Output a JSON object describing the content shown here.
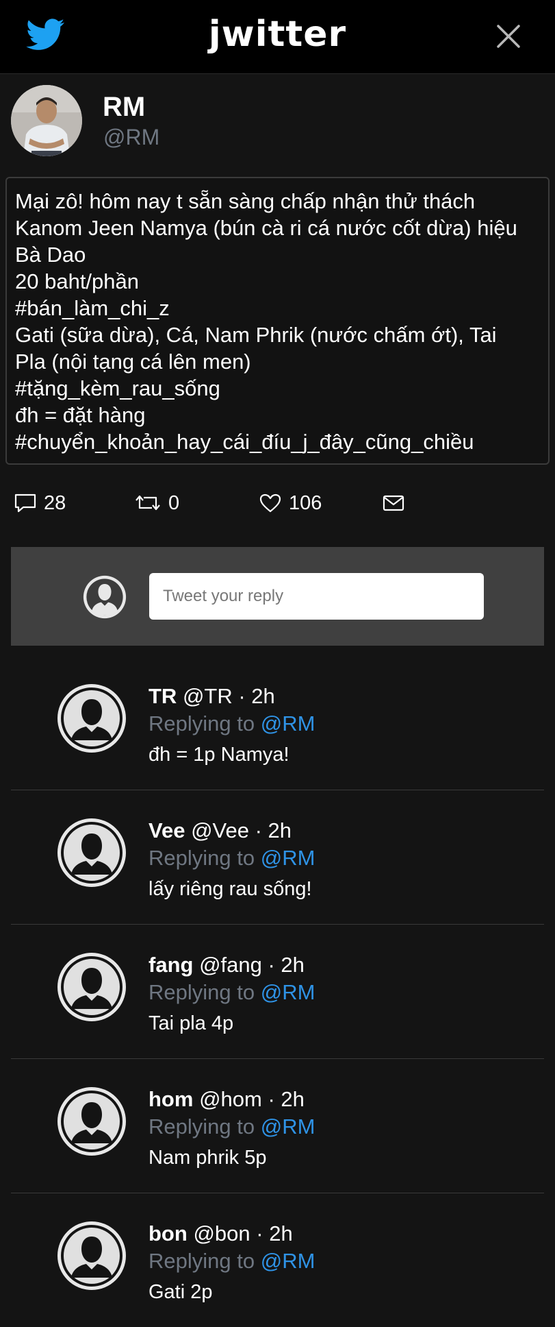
{
  "header": {
    "logo": "jwitter",
    "bird_icon": "twitter-bird-icon",
    "close_icon": "close-icon",
    "brand_color": "#1da1f2"
  },
  "profile": {
    "name": "RM",
    "handle": "@RM"
  },
  "tweet": {
    "lines": [
      "Mại zô! hôm nay t sẵn sàng chấp nhận thử thách",
      "Kanom Jeen Namya (bún cà ri cá nước cốt dừa) hiệu",
      "Bà Dao",
      "20 baht/phần",
      "#bán_làm_chi_z",
      "Gati (sữa dừa), Cá, Nam Phrik (nước chấm ớt), Tai",
      "Pla (nội tạng cá lên men)",
      "#tặng_kèm_rau_sống",
      "đh = đặt hàng",
      "#chuyển_khoản_hay_cái_đíu_j_đây_cũng_chiều"
    ]
  },
  "actions": {
    "replies": "28",
    "retweets": "0",
    "likes": "106",
    "reply_icon": "comment-icon",
    "retweet_icon": "retweet-icon",
    "like_icon": "heart-icon",
    "message_icon": "mail-icon"
  },
  "composer": {
    "placeholder": "Tweet your reply"
  },
  "replies": [
    {
      "name": "TR",
      "handle": "@TR",
      "time": "· 2h",
      "replying_label": "Replying to",
      "mention": "@RM",
      "text": "đh = 1p Namya!"
    },
    {
      "name": "Vee",
      "handle": "@Vee",
      "time": "· 2h",
      "replying_label": "Replying to",
      "mention": "@RM",
      "text": "lấy riêng rau sống!"
    },
    {
      "name": "fang",
      "handle": "@fang",
      "time": "· 2h",
      "replying_label": "Replying to",
      "mention": "@RM",
      "text": "Tai pla 4p"
    },
    {
      "name": "hom",
      "handle": "@hom",
      "time": "· 2h",
      "replying_label": "Replying to",
      "mention": "@RM",
      "text": "Nam phrik 5p"
    },
    {
      "name": "bon",
      "handle": "@bon",
      "time": "· 2h",
      "replying_label": "Replying to",
      "mention": "@RM",
      "text": "Gati 2p"
    }
  ]
}
